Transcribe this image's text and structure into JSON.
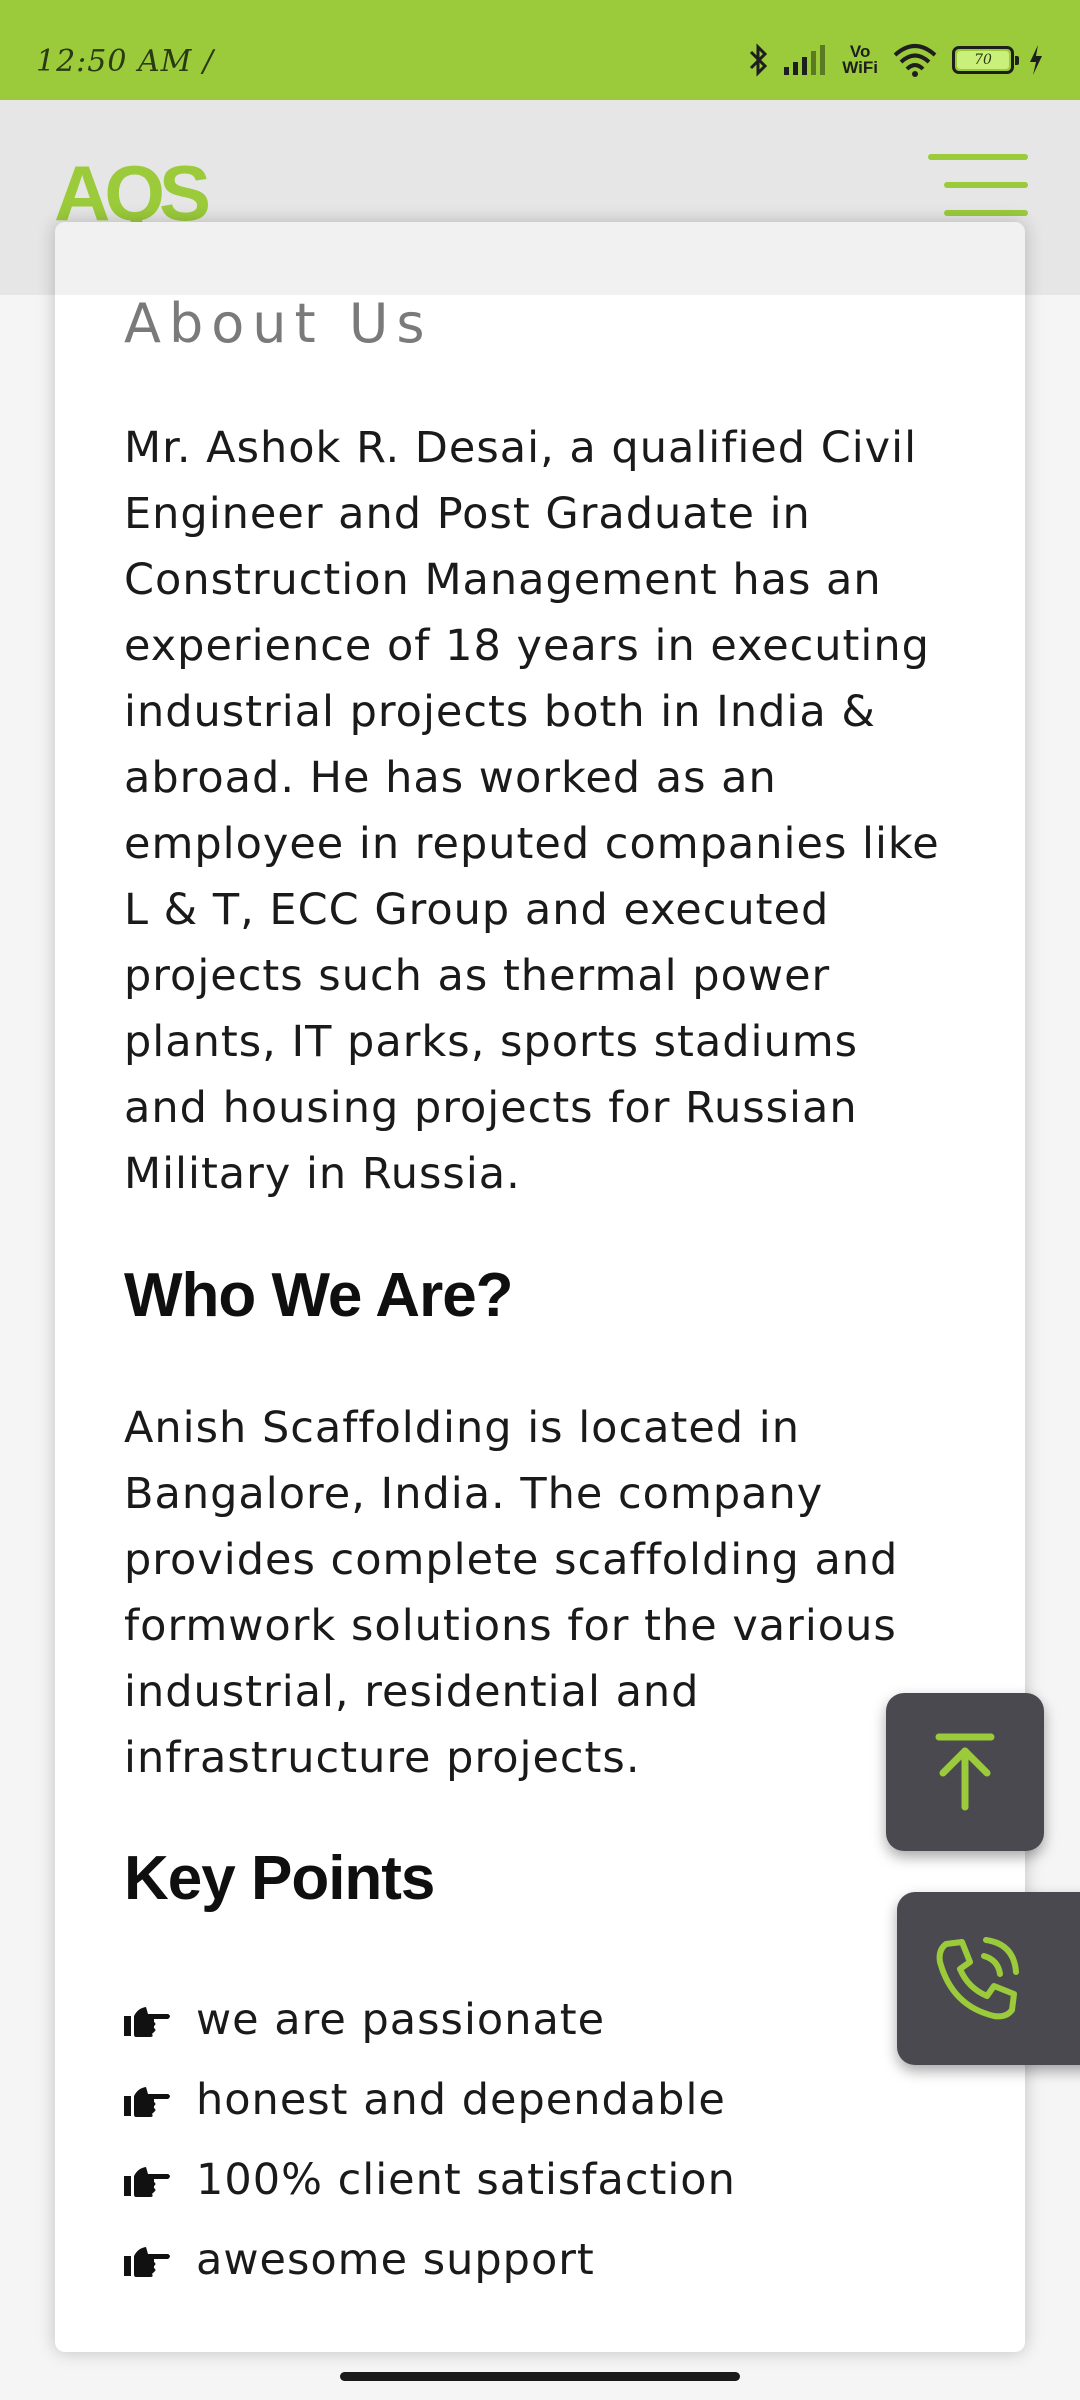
{
  "status_bar": {
    "time": "12:50 AM /",
    "network_label": "Vo\nWiFi",
    "battery_level": "70"
  },
  "header": {
    "logo_text": "AQS"
  },
  "about": {
    "heading": "About Us",
    "body": "Mr. Ashok R. Desai, a qualified Civil Engineer and Post Graduate in Construction Management has an experience of 18 years in executing industrial projects both in India & abroad. He has worked as an employee in reputed companies like L & T, ECC Group and executed projects such as thermal power plants, IT parks, sports stadiums and housing projects for Russian Military in Russia."
  },
  "who": {
    "heading": "Who We Are?",
    "body": "Anish Scaffolding is located in Bangalore, India. The company provides complete scaffolding and formwork solutions for the various industrial, residential and infrastructure projects."
  },
  "key_points": {
    "heading": "Key Points",
    "items": [
      {
        "text": "we are passionate"
      },
      {
        "text": "honest and dependable"
      },
      {
        "text": "100% client satisfaction"
      },
      {
        "text": "awesome support"
      }
    ]
  },
  "colors": {
    "accent": "#9bcb3b",
    "fab_background": "#4a4950"
  },
  "icons": {
    "menu": "hamburger-menu-icon",
    "scroll_top": "arrow-up-to-line-icon",
    "call": "phone-ringing-icon",
    "bullet": "hand-pointing-right-icon"
  }
}
